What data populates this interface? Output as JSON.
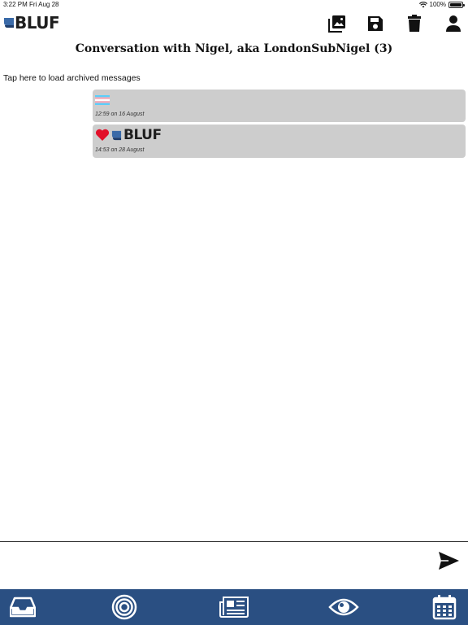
{
  "status_bar": {
    "time": "3:22 PM",
    "date": "Fri Aug 28",
    "battery": "100%",
    "battery_level": 1.0
  },
  "header": {
    "logo_text": "BLUF",
    "icons": [
      "photo-gallery-icon",
      "save-icon",
      "trash-icon",
      "person-icon"
    ]
  },
  "title": "Conversation with Nigel, aka LondonSubNigel (3)",
  "archived_link": "Tap here to load archived messages",
  "messages": [
    {
      "content": "flag-emoji",
      "time": "12:59 on 16 August"
    },
    {
      "content": "heart-emoji + BLUF logo",
      "logo_text": "BLUF",
      "time": "14:53 on 28 August"
    }
  ],
  "compose": {
    "placeholder": "",
    "value": ""
  },
  "tab_bar": {
    "icons": [
      "inbox-icon",
      "target-icon",
      "news-icon",
      "eye-icon",
      "calendar-icon"
    ]
  },
  "colors": {
    "tab_bar": "#2a4f82",
    "bubble": "#cdcdcd",
    "logo_blue": "#3a6aa8"
  }
}
